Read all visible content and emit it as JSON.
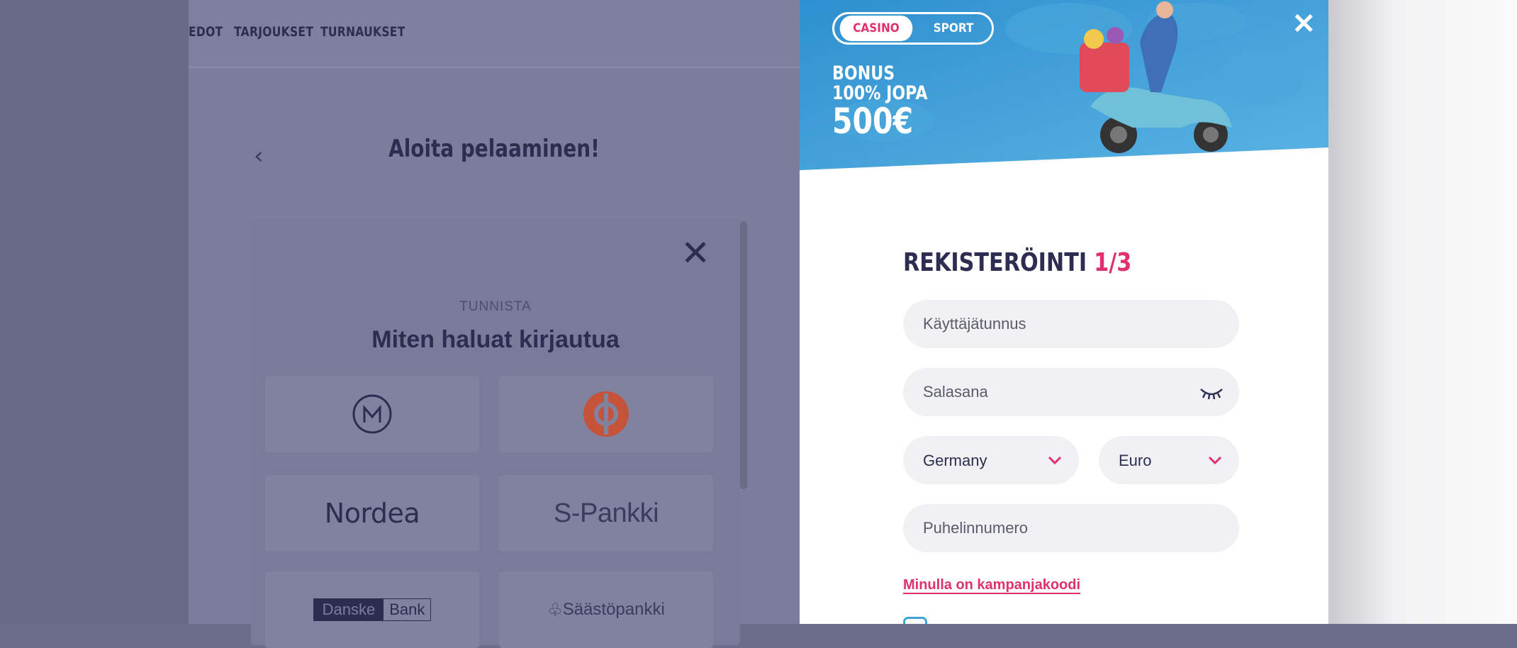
{
  "nav": {
    "items": [
      "EDOT",
      "TARJOUKSET",
      "TURNAUKSET"
    ]
  },
  "page": {
    "title": "Aloita pelaaminen!"
  },
  "login_modal": {
    "subtitle": "TUNNISTA",
    "title": "Miten haluat kirjautua",
    "banks": [
      "Mobiilivarmenne",
      "OP",
      "Nordea",
      "S-Pankki",
      "Danske Bank",
      "Säästöpankki"
    ],
    "nordea": "Nordea",
    "spankki": "S-Pankki",
    "danske_a": "Danske",
    "danske_b": "Bank",
    "saasto": "Säästöpankki"
  },
  "registration": {
    "toggle": {
      "casino": "CASINO",
      "sport": "SPORT",
      "selected": "CASINO"
    },
    "bonus": {
      "line1": "BONUS",
      "line2": "100% JOPA",
      "line3": "500€"
    },
    "title": "REKISTERÖINTI",
    "step": "1/3",
    "username_placeholder": "Käyttäjätunnus",
    "password_placeholder": "Salasana",
    "country": "Germany",
    "currency": "Euro",
    "phone_placeholder": "Puhelinnumero",
    "promo_link": "Minulla on kampanjakoodi"
  },
  "colors": {
    "accent": "#e0306f",
    "navy": "#2c2d50",
    "hero_blue": "#3a9fd6",
    "overlay": "#7c7d9c"
  }
}
